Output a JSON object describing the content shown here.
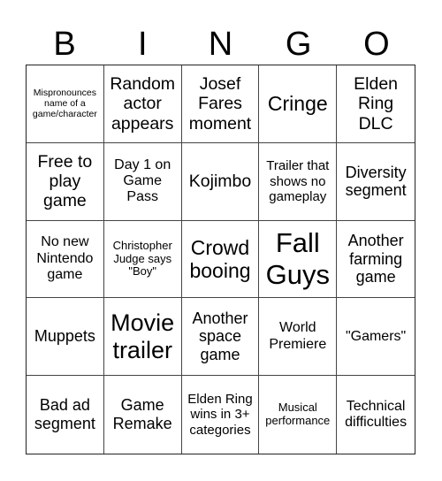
{
  "header": {
    "letters": [
      "B",
      "I",
      "N",
      "G",
      "O"
    ]
  },
  "cells": [
    "Mispronounces name of a game/character",
    "Random actor appears",
    "Josef Fares moment",
    "Cringe",
    "Elden Ring DLC",
    "Free to play game",
    "Day 1 on Game Pass",
    "Kojimbo",
    "Trailer that shows no gameplay",
    "Diversity segment",
    "No new Nintendo game",
    "Christopher Judge says \"Boy\"",
    "Crowd booing",
    "Fall Guys",
    "Another farming game",
    "Muppets",
    "Movie trailer",
    "Another space game",
    "World Premiere",
    "\"Gamers\"",
    "Bad ad segment",
    "Game Remake",
    "Elden Ring wins in 3+ categories",
    "Musical performance",
    "Technical difficulties"
  ]
}
